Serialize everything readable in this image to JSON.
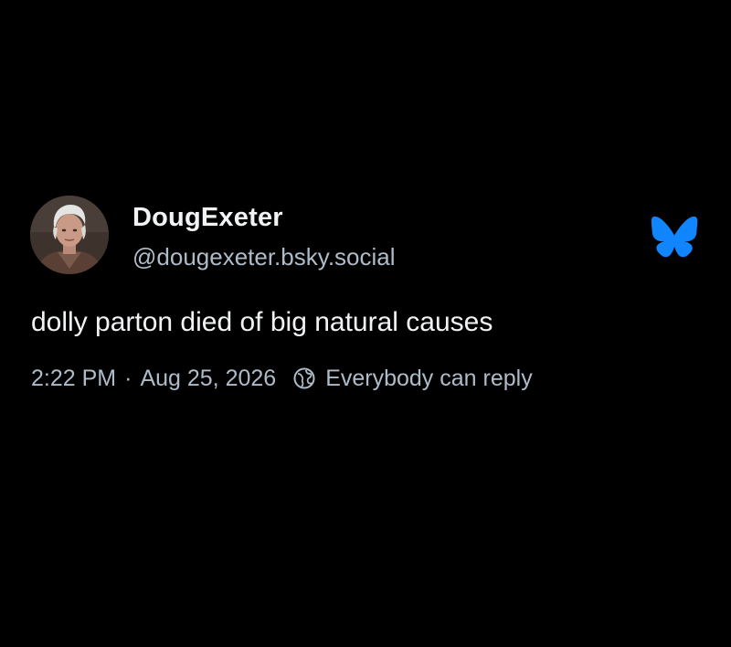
{
  "post": {
    "author": {
      "display_name": "DougExeter",
      "handle": "@dougexeter.bsky.social",
      "avatar_icon": "profile-photo"
    },
    "text": "dolly parton died of big natural causes",
    "meta": {
      "time": "2:22 PM",
      "separator": "·",
      "date": "Aug 25, 2026",
      "reply_setting_icon": "globe-icon",
      "reply_setting": "Everybody can reply"
    },
    "brand_icon": "bluesky-butterfly-icon"
  },
  "colors": {
    "background": "#000000",
    "primary_text": "#f1f3f5",
    "secondary_text": "#aebbc9",
    "brand": "#1185fe"
  }
}
